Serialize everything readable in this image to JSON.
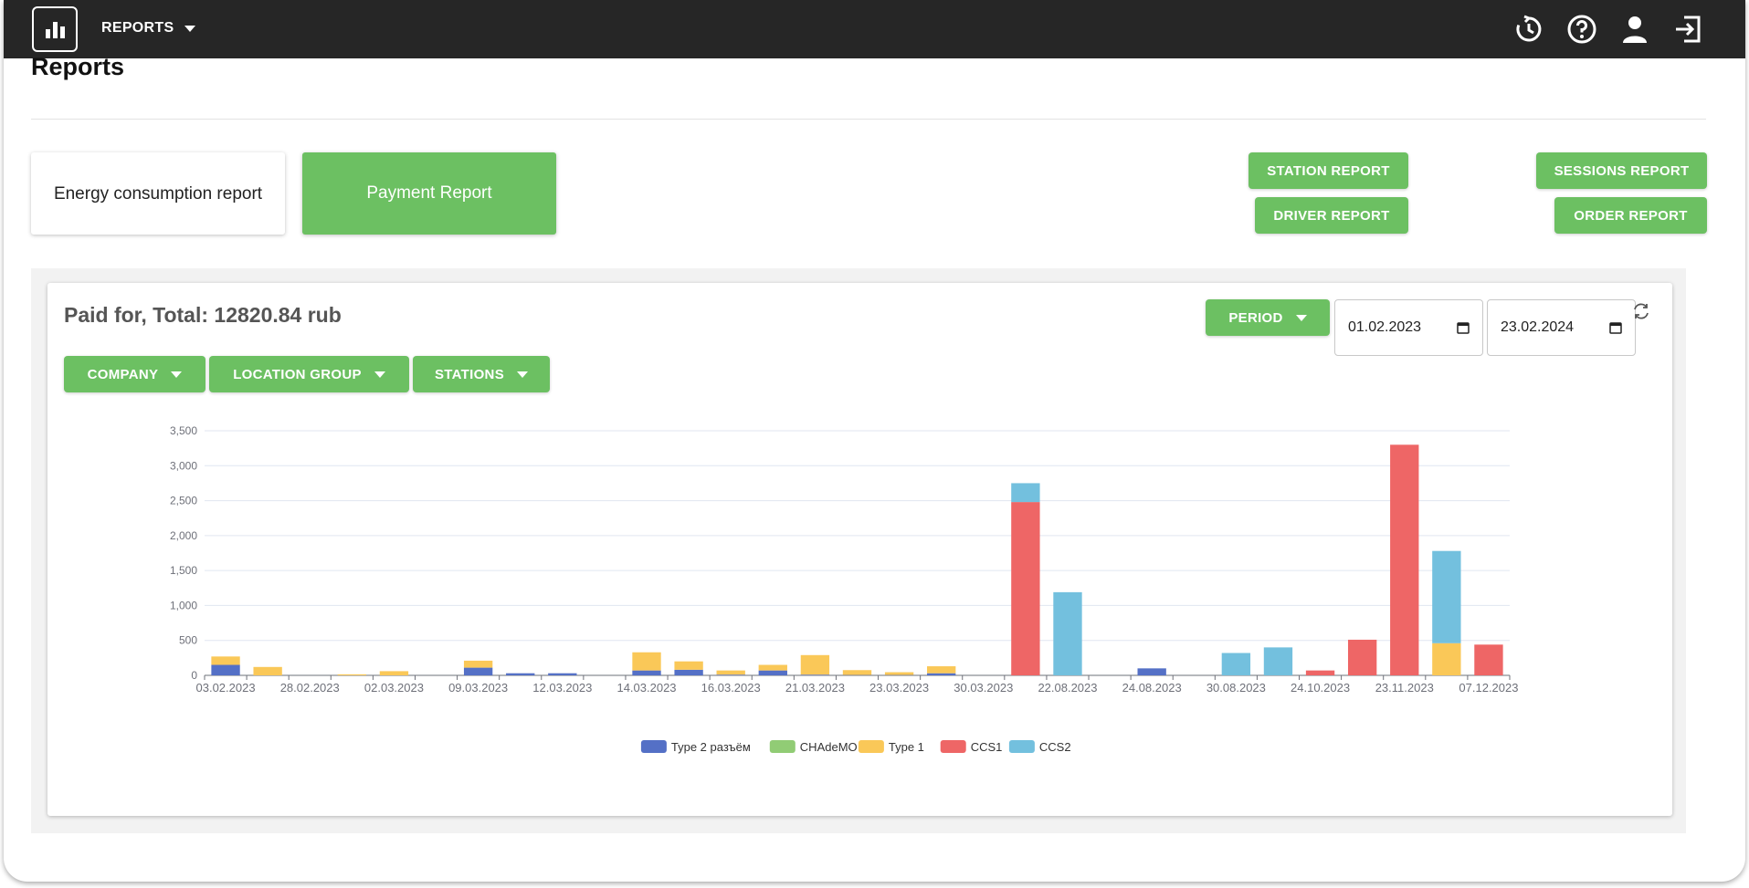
{
  "topbar": {
    "menu_label": "REPORTS",
    "icons": [
      "history-icon",
      "help-icon",
      "user-icon",
      "logout-icon"
    ]
  },
  "page": {
    "title": "Reports"
  },
  "report_tabs": {
    "energy": "Energy consumption report",
    "payment": "Payment Report"
  },
  "report_buttons": {
    "station": "STATION REPORT",
    "driver": "DRIVER REPORT",
    "sessions": "SESSIONS REPORT",
    "order": "ORDER REPORT"
  },
  "panel": {
    "title": "Paid for, Total: 12820.84 rub",
    "period_label": "PERIOD",
    "date_from": "01.02.2023",
    "date_to": "23.02.2024",
    "filters": {
      "company": "COMPANY",
      "location_group": "LOCATION GROUP",
      "stations": "STATIONS"
    }
  },
  "colors": {
    "accent": "#6cc062",
    "topbar": "#262626"
  },
  "chart_data": {
    "type": "bar",
    "stacked": true,
    "ylim": [
      0,
      3500
    ],
    "yticks": [
      "0",
      "500",
      "1,000",
      "1,500",
      "2,000",
      "2,500",
      "3,000",
      "3,500"
    ],
    "grid": true,
    "legend_position": "bottom",
    "categories": [
      "03.02.2023",
      "",
      "28.02.2023",
      "",
      "02.03.2023",
      "",
      "09.03.2023",
      "",
      "12.03.2023",
      "",
      "14.03.2023",
      "",
      "16.03.2023",
      "",
      "21.03.2023",
      "",
      "23.03.2023",
      "",
      "30.03.2023",
      "",
      "22.08.2023",
      "",
      "24.08.2023",
      "",
      "30.08.2023",
      "",
      "24.10.2023",
      "",
      "23.11.2023",
      "",
      "07.12.2023"
    ],
    "series": [
      {
        "name": "Type 2 разъём",
        "color": "#5470c6",
        "values": [
          150,
          0,
          0,
          0,
          0,
          0,
          110,
          30,
          30,
          0,
          70,
          80,
          10,
          70,
          10,
          5,
          5,
          30,
          0,
          0,
          0,
          0,
          100,
          0,
          0,
          0,
          0,
          0,
          0,
          0,
          0
        ]
      },
      {
        "name": "CHAdeMO",
        "color": "#91cc75",
        "values": [
          0,
          0,
          0,
          0,
          0,
          0,
          0,
          0,
          0,
          0,
          0,
          0,
          0,
          0,
          0,
          0,
          0,
          0,
          0,
          0,
          0,
          0,
          0,
          0,
          0,
          0,
          0,
          0,
          0,
          0,
          0
        ]
      },
      {
        "name": "Type 1",
        "color": "#fac858",
        "values": [
          120,
          120,
          0,
          15,
          60,
          0,
          100,
          0,
          0,
          0,
          260,
          120,
          60,
          80,
          280,
          70,
          40,
          100,
          0,
          0,
          0,
          0,
          0,
          0,
          0,
          0,
          0,
          0,
          0,
          460,
          0
        ]
      },
      {
        "name": "CCS1",
        "color": "#ee6666",
        "values": [
          0,
          0,
          0,
          0,
          0,
          0,
          0,
          0,
          0,
          0,
          0,
          0,
          0,
          0,
          0,
          0,
          0,
          0,
          0,
          2480,
          0,
          0,
          0,
          0,
          0,
          0,
          70,
          510,
          3300,
          0,
          440
        ]
      },
      {
        "name": "CCS2",
        "color": "#73c0de",
        "values": [
          0,
          0,
          0,
          0,
          0,
          0,
          0,
          0,
          0,
          0,
          0,
          0,
          0,
          0,
          0,
          0,
          0,
          0,
          0,
          270,
          1190,
          0,
          0,
          0,
          320,
          400,
          0,
          0,
          0,
          1320,
          0
        ]
      }
    ]
  }
}
